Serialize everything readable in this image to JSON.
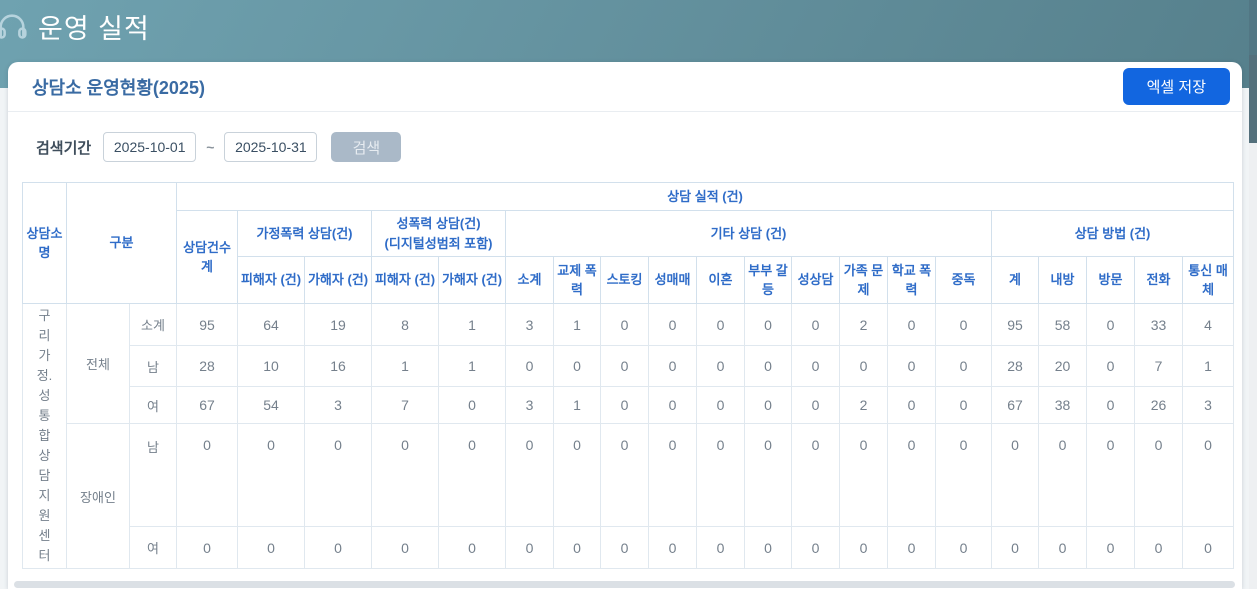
{
  "app_header": {
    "title": "운영 실적",
    "icon": "headset-icon"
  },
  "panel": {
    "title": "상담소 운영현황(2025)",
    "excel_button_label": "엑셀 저장"
  },
  "search": {
    "label": "검색기간",
    "date_from": "2025-10-01",
    "separator": "~",
    "date_to": "2025-10-31",
    "button_label": "검색"
  },
  "table": {
    "head": {
      "center_name": "상담소\n명",
      "category": "구분",
      "performance": "상담 실적 (건)",
      "total_count": "상담건수 계",
      "domestic_violence": "가정폭력 상담(건)",
      "sexual_violence": "성폭력 상담(건)\n(디지털성범죄 포함)",
      "other_counseling": "기타 상담 (건)",
      "method": "상담 방법 (건)",
      "victim": "피해자 (건)",
      "offender": "가해자 (건)",
      "other_cols": [
        "소계",
        "교제 폭력",
        "스토킹",
        "성매매",
        "이혼",
        "부부 갈등",
        "성상담",
        "가족 문제",
        "학교 폭력",
        "중독"
      ],
      "method_cols": [
        "계",
        "내방",
        "방문",
        "전화",
        "통신 매체"
      ]
    },
    "center_name_display": "구\n리\n가\n정.\n성\n통\n합\n상\n담\n지\n원\n센\n터",
    "groups": [
      {
        "label": "전체",
        "rows": [
          {
            "label": "소계",
            "values": [
              95,
              64,
              19,
              8,
              1,
              3,
              1,
              0,
              0,
              0,
              0,
              0,
              2,
              0,
              0,
              95,
              58,
              0,
              33,
              4
            ]
          },
          {
            "label": "남",
            "values": [
              28,
              10,
              16,
              1,
              1,
              0,
              0,
              0,
              0,
              0,
              0,
              0,
              0,
              0,
              0,
              28,
              20,
              0,
              7,
              1
            ]
          },
          {
            "label": "여",
            "values": [
              67,
              54,
              3,
              7,
              0,
              3,
              1,
              0,
              0,
              0,
              0,
              0,
              2,
              0,
              0,
              67,
              38,
              0,
              26,
              3
            ]
          }
        ]
      },
      {
        "label": "장애인",
        "rows": [
          {
            "label": "남",
            "values": [
              0,
              0,
              0,
              0,
              0,
              0,
              0,
              0,
              0,
              0,
              0,
              0,
              0,
              0,
              0,
              0,
              0,
              0,
              0,
              0
            ]
          },
          {
            "label": "여",
            "values": [
              0,
              0,
              0,
              0,
              0,
              0,
              0,
              0,
              0,
              0,
              0,
              0,
              0,
              0,
              0,
              0,
              0,
              0,
              0,
              0
            ]
          }
        ]
      }
    ]
  },
  "colors": {
    "header_teal": "#628f9c",
    "accent_blue": "#1266e0",
    "table_header_text": "#2f6cc8",
    "search_button_gray": "#aab9c8"
  }
}
